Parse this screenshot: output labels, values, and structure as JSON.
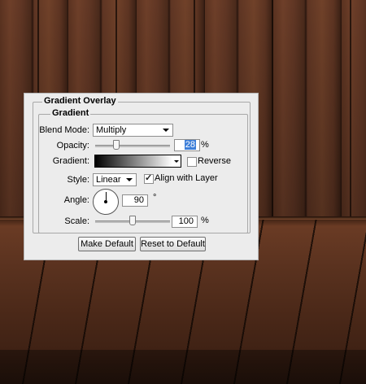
{
  "panel": {
    "section_title": "Gradient Overlay",
    "group_title": "Gradient"
  },
  "blend_mode": {
    "label": "Blend Mode:",
    "value": "Multiply"
  },
  "opacity": {
    "label": "Opacity:",
    "value": "28",
    "unit": "%",
    "slider_fraction": 0.28
  },
  "gradient": {
    "label": "Gradient:",
    "reverse_label": "Reverse",
    "reverse_checked": false,
    "colors": [
      "#000000",
      "#ffffff"
    ]
  },
  "style": {
    "label": "Style:",
    "value": "Linear",
    "align_label": "Align with Layer",
    "align_checked": true
  },
  "angle": {
    "label": "Angle:",
    "value": "90",
    "unit": "°"
  },
  "scale": {
    "label": "Scale:",
    "value": "100",
    "unit": "%",
    "slider_fraction": 0.5
  },
  "buttons": {
    "make_default": "Make Default",
    "reset_default": "Reset to Default"
  },
  "icons": {
    "dropdown": "chevron-down-icon",
    "angle": "angle-dial-icon",
    "check": "check-icon"
  }
}
